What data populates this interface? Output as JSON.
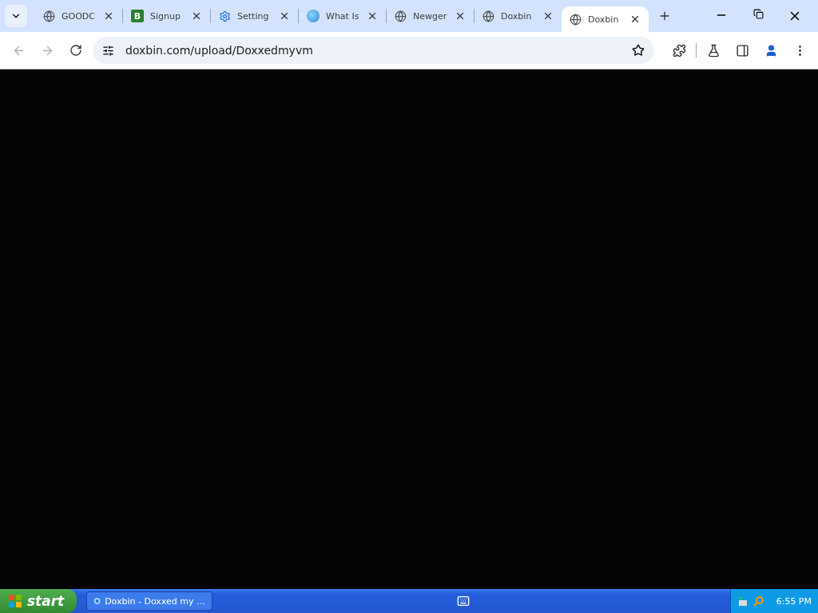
{
  "tabs": [
    {
      "title": "GOODC",
      "kind": "globe",
      "selected": false
    },
    {
      "title": "Signup",
      "kind": "letter",
      "letter": "B",
      "selected": false
    },
    {
      "title": "Setting",
      "kind": "gear",
      "selected": false
    },
    {
      "title": "What Is",
      "kind": "sphere",
      "selected": false
    },
    {
      "title": "Newger",
      "kind": "globe",
      "selected": false
    },
    {
      "title": "Doxbin",
      "kind": "globe",
      "selected": false
    },
    {
      "title": "Doxbin",
      "kind": "globe",
      "selected": true
    }
  ],
  "address_bar": {
    "url": "doxbin.com/upload/Doxxedmyvm"
  },
  "taskbar": {
    "start": "start",
    "windows": [
      {
        "title": "Doxbin - Doxxed my …",
        "selected": false
      }
    ],
    "clock": "6:55 PM"
  }
}
